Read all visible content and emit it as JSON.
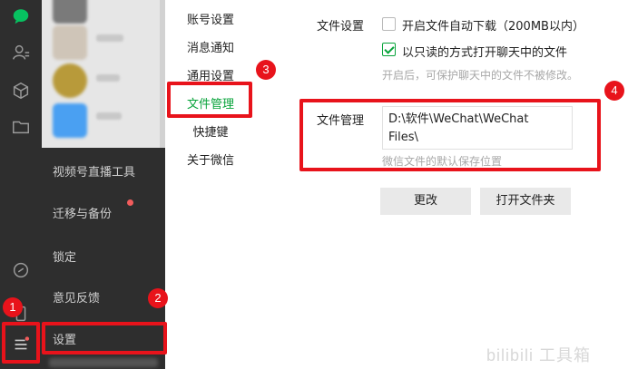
{
  "rail": {
    "icons": [
      "chat-icon",
      "contacts-icon",
      "cube-icon",
      "folder-icon",
      "link-icon",
      "phone-icon",
      "menu-icon"
    ],
    "accent": "#07c160"
  },
  "more_menu": {
    "items": [
      {
        "label": "视频号直播工具",
        "dot": false
      },
      {
        "label": "迁移与备份",
        "dot": true
      },
      {
        "label": "锁定",
        "dot": false
      },
      {
        "label": "意见反馈",
        "dot": false
      },
      {
        "label": "设置",
        "dot": false
      }
    ]
  },
  "settings_nav": {
    "items": [
      {
        "label": "账号设置",
        "active": false
      },
      {
        "label": "消息通知",
        "active": false
      },
      {
        "label": "通用设置",
        "active": false
      },
      {
        "label": "文件管理",
        "active": true
      },
      {
        "label": "快捷键",
        "active": false
      },
      {
        "label": "关于微信",
        "active": false
      }
    ],
    "active_color": "#07a33a"
  },
  "file_settings": {
    "section_label": "文件设置",
    "auto_download": {
      "label": "开启文件自动下载（200MB以内）",
      "checked": false
    },
    "read_only": {
      "label": "以只读的方式打开聊天中的文件",
      "checked": true
    },
    "read_only_hint": "开启后，可保护聊天中的文件不被修改。"
  },
  "file_management": {
    "section_label": "文件管理",
    "path_line1": "D:\\软件\\WeChat\\WeChat",
    "path_line2": "Files\\",
    "path_hint": "微信文件的默认保存位置",
    "change_button": "更改",
    "open_folder_button": "打开文件夹"
  },
  "annotations": {
    "badges": [
      "1",
      "2",
      "3",
      "4"
    ],
    "color": "#e8131b"
  },
  "watermark": "bilibili 工具箱"
}
